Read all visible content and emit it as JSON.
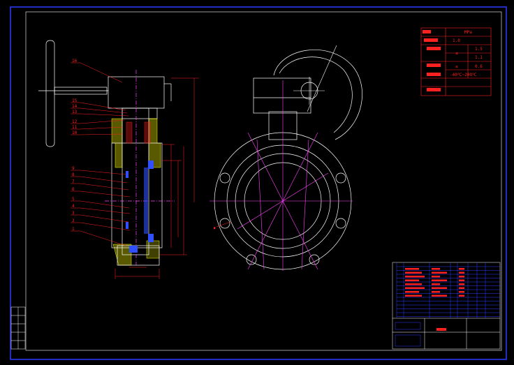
{
  "colors": {
    "background": "#000000",
    "frame": "#2a3cff",
    "outline": "#ffffff",
    "dimension": "#ff2020",
    "centerline": "#ff40ff",
    "hatch": "#ffff00",
    "detail": "#3050ff"
  },
  "part_labels": [
    "16",
    "15",
    "14",
    "13",
    "12",
    "11",
    "10",
    "9",
    "8",
    "7",
    "6",
    "5",
    "4",
    "3",
    "2",
    "1"
  ],
  "spec_table": {
    "rows": [
      {
        "label": "",
        "value": "1.0"
      },
      {
        "label": "",
        "value": "1.5"
      },
      {
        "label": "",
        "value": "1.1"
      },
      {
        "label": "",
        "value": "0.6"
      },
      {
        "label": "",
        "value": "-40℃~200℃"
      },
      {
        "label": "",
        "value": ""
      }
    ],
    "unit": "MPa",
    "symbols": [
      "≤",
      "≤"
    ]
  }
}
